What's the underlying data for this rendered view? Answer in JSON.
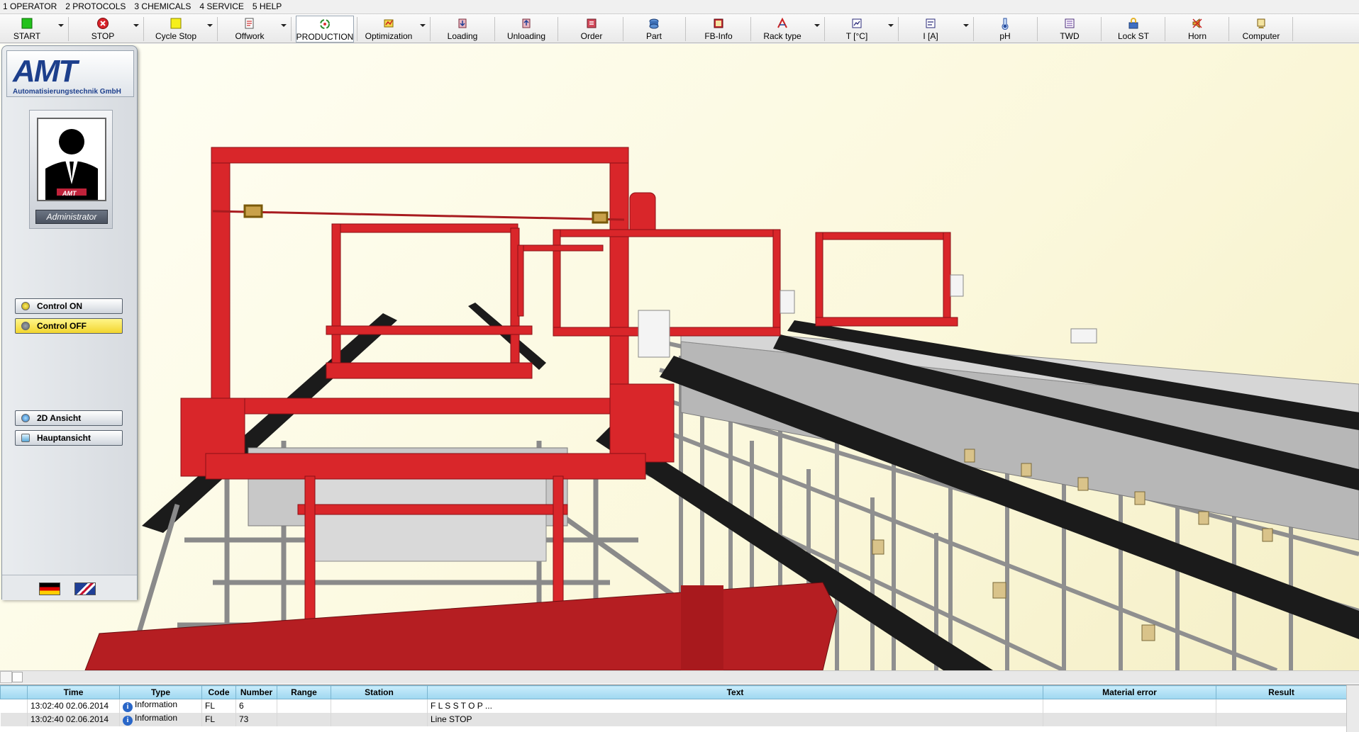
{
  "menu": [
    "1 OPERATOR",
    "2 PROTOCOLS",
    "3 CHEMICALS",
    "4 SERVICE",
    "5 HELP"
  ],
  "toolbar": [
    {
      "label": "START",
      "icon": "start-green-square-icon"
    },
    {
      "label": "STOP",
      "icon": "stop-red-circle-icon"
    },
    {
      "label": "Cycle Stop",
      "icon": "cycle-stop-yellow-square-icon"
    },
    {
      "label": "Offwork",
      "icon": "offwork-document-icon"
    },
    {
      "label": "PRODUCTION",
      "icon": "production-recycle-icon"
    },
    {
      "label": "Optimization",
      "icon": "optimization-icon"
    },
    {
      "label": "Loading",
      "icon": "loading-icon"
    },
    {
      "label": "Unloading",
      "icon": "unloading-icon"
    },
    {
      "label": "Order",
      "icon": "order-icon"
    },
    {
      "label": "Part",
      "icon": "part-icon"
    },
    {
      "label": "FB-Info",
      "icon": "fb-info-icon"
    },
    {
      "label": "Rack type",
      "icon": "rack-type-icon"
    },
    {
      "label": "T [°C]",
      "icon": "temperature-icon"
    },
    {
      "label": "I [A]",
      "icon": "current-icon"
    },
    {
      "label": "pH",
      "icon": "ph-icon"
    },
    {
      "label": "TWD",
      "icon": "twd-icon"
    },
    {
      "label": "Lock ST",
      "icon": "lock-station-icon"
    },
    {
      "label": "Horn",
      "icon": "horn-icon"
    },
    {
      "label": "Computer",
      "icon": "computer-icon"
    }
  ],
  "side": {
    "logo": "AMT",
    "company": "Automatisierungstechnik GmbH",
    "avatar_logo": "AMT",
    "role": "Administrator",
    "control_on": "Control ON",
    "control_off": "Control OFF",
    "view_2d": "2D Ansicht",
    "main_view": "Hauptansicht",
    "flags": [
      "german-flag-icon",
      "english-flag-icon"
    ]
  },
  "messages": {
    "columns": [
      "Time",
      "Type",
      "Code",
      "Number",
      "Range",
      "Station",
      "Text",
      "Material error",
      "Result"
    ],
    "rows": [
      {
        "time": "13:02:40  02.06.2014",
        "type": "Information",
        "code": "FL",
        "number": "6",
        "range": "",
        "station": "",
        "text": "F L S   S T O P ...",
        "material_error": "",
        "result": ""
      },
      {
        "time": "13:02:40  02.06.2014",
        "type": "Information",
        "code": "FL",
        "number": "73",
        "range": "",
        "station": "",
        "text": "Line STOP",
        "material_error": "",
        "result": ""
      }
    ]
  },
  "colors": {
    "accent_red": "#d9262a",
    "rail_black": "#1b1b1b",
    "frame_gray": "#9a9a9a",
    "header_blue": "#a9dcf3"
  }
}
